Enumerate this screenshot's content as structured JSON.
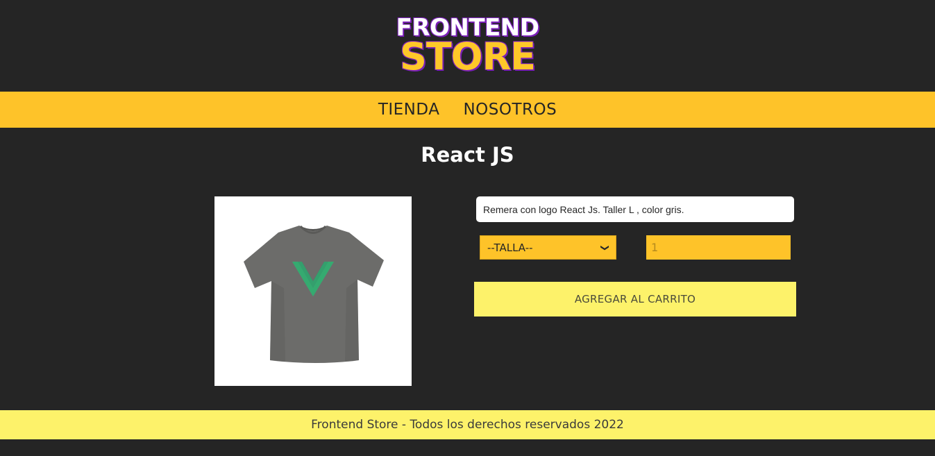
{
  "header": {
    "logo_top": "FRONTEND",
    "logo_bottom": "STORE"
  },
  "nav": {
    "items": [
      {
        "label": "TIENDA"
      },
      {
        "label": "NOSOTROS"
      }
    ]
  },
  "product": {
    "title": "React JS",
    "description": "Remera con logo React Js. Taller L , color gris.",
    "size_select": {
      "selected": "--TALLA--"
    },
    "quantity": {
      "placeholder": "1"
    },
    "add_button_label": "AGREGAR AL CARRITO"
  },
  "footer": {
    "text": "Frontend Store - Todos los derechos reservados 2022"
  },
  "colors": {
    "background": "#252525",
    "nav_bg": "#fec329",
    "button_bg": "#fdf26a",
    "accent_purple": "#7a1fb8"
  }
}
